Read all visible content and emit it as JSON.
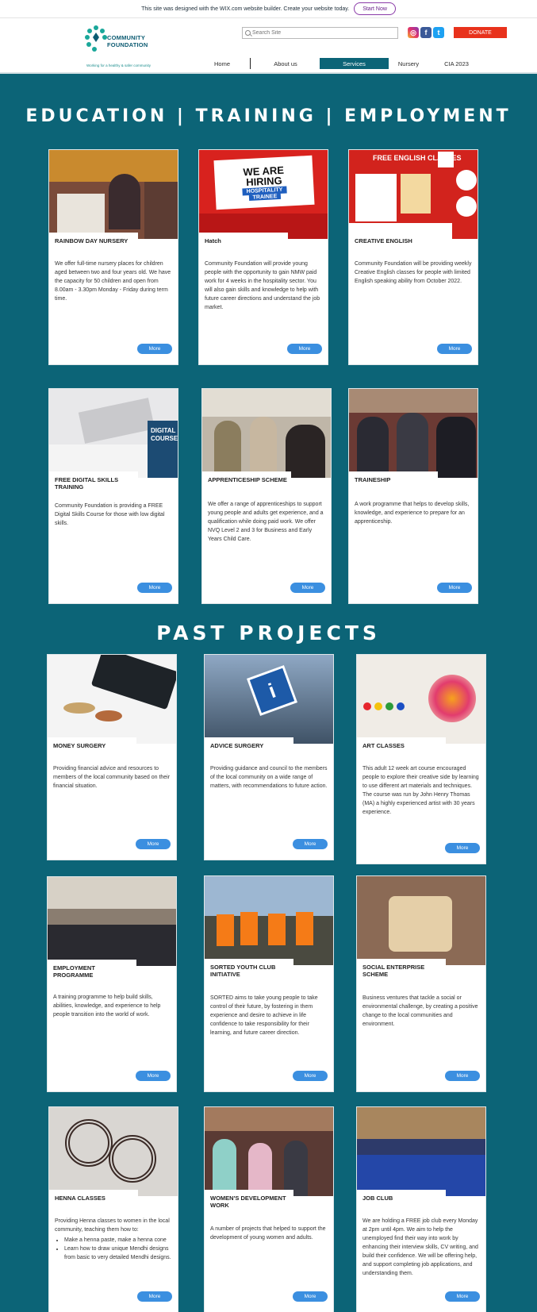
{
  "banner": {
    "text": "This site was designed with the WIX.com website builder. Create your website today.",
    "start_now": "Start Now"
  },
  "header": {
    "logo_line1": "COMMUNITY",
    "logo_line2": "FOUNDATION",
    "logo_tagline": "Working for a healthy & safer community",
    "search_placeholder": "Search Site",
    "donate": "DONATE",
    "social_icons": [
      "instagram-icon",
      "facebook-icon",
      "twitter-icon"
    ],
    "nav": [
      "Home",
      "About us",
      "Services",
      "Nursery",
      "CIA 2023"
    ],
    "active_nav": "Services"
  },
  "sections": {
    "education": "EDUCATION | TRAINING | EMPLOYMENT",
    "past": "PAST PROJECTS"
  },
  "more_label": "More",
  "cards": [
    {
      "title": "RAINBOW DAY NURSERY",
      "desc": "We offer full-time nursery places for children aged between two and four years old. We have the capacity for 50 children and open from 8.00am - 3.30pm Monday - Friday during term time."
    },
    {
      "title": "Hatch",
      "desc": "Community Foundation will provide young people with the opportunity to gain NMW paid work for 4 weeks in the hospitality sector. You will also gain skills and knowledge to help with future career directions  and  understand the job market."
    },
    {
      "title": "CREATIVE ENGLISH",
      "desc": "Community Foundation will be providing weekly Creative English classes for people with limited English speaking ability from October 2022."
    },
    {
      "title": "FREE DIGITAL SKILLS TRAINING",
      "desc": "Community Foundation is providing a FREE Digital Skills Course for those with low digital skills."
    },
    {
      "title": "APPRENTICESHIP SCHEME",
      "desc": "We offer a range of apprenticeships to support young people and adults get experience, and a qualification while doing paid work. We offer NVQ Level 2 and 3 for Business and Early Years Child Care."
    },
    {
      "title": "TRAINESHIP",
      "desc": "A work programme that helps to develop skills, knowledge, and experience to prepare for an apprenticeship."
    },
    {
      "title": "MONEY SURGERY",
      "desc": "Providing financial advice and resources to members of the local community based on their financial situation."
    },
    {
      "title": "ADVICE SURGERY",
      "desc": "Providing guidance and council to the members of the local community on a wide range of matters, with recommendations to future action."
    },
    {
      "title": "ART CLASSES",
      "desc": "This adult 12 week art course encouraged people to explore their creative side by learning to use different art materials and techniques. The course was run by John Henry Thomas (MA) a highly experienced artist with 30 years experience."
    },
    {
      "title": "EMPLOYMENT PROGRAMME",
      "desc": "A training programme to help build skills, abilities, knowledge, and experience to help people transition into the world of work."
    },
    {
      "title": "SORTED YOUTH CLUB INITIATIVE",
      "desc": "SORTED aims to take young people to take control of their future, by fostering in them experience and desire to achieve in life confidence to take responsibility for their learning, and future career direction."
    },
    {
      "title": "SOCIAL ENTERPRISE SCHEME",
      "desc": "Business ventures that tackle a social or environmental challenge, by creating a positive change to the local communities and environment."
    },
    {
      "title": "HENNA CLASSES",
      "desc": "Providing Henna classes to women in the local community, teaching them how to:",
      "bullets": [
        "Make a henna paste, make a henna cone",
        "Learn how to draw unique Mendhi designs from basic to very detailed Mendhi designs."
      ]
    },
    {
      "title": "WOMEN'S DEVELOPMENT WORK",
      "desc": "A number of projects that helped to support the development of young women and adults."
    },
    {
      "title": "JOB CLUB",
      "desc": "We are holding a FREE job club every Monday at 2pm until 4pm. We aim to help the unemployed find their way into work by enhancing their interview skills, CV writing, and build their confidence. We will be offering help, and support completing job applications, and understanding them."
    }
  ],
  "poster_text": {
    "hiring_line1": "WE ARE",
    "hiring_line2": "HIRING",
    "hiring_line3": "HOSPITALITY",
    "hiring_line4": "TRAINEE",
    "english_heading": "FREE ENGLISH CLASSES",
    "digital_heading": "DIGITAL",
    "digital_sub": "COURSE"
  },
  "colors": {
    "page_bg": "#0c6477",
    "more_button": "#3b8fe0",
    "donate": "#e8321c",
    "nav_active": "#0c6477"
  }
}
